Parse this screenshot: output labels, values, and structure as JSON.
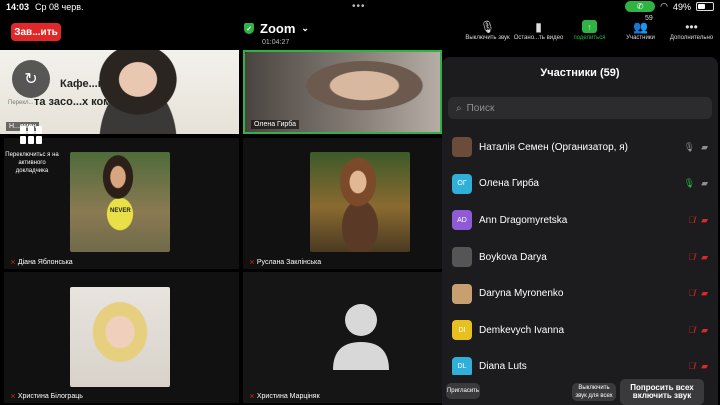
{
  "status_bar": {
    "time": "14:03",
    "date": "Ср 08 черв.",
    "battery": "49%"
  },
  "top_bar": {
    "leave_label": "Зав...ить",
    "app_title": "Zoom",
    "elapsed": "01:04:27"
  },
  "toolbar": [
    {
      "label": "Выключить звук",
      "icon": "mic-icon",
      "glyph": "🎙"
    },
    {
      "label": "Остано...ть видео",
      "icon": "camera-icon",
      "glyph": "▮"
    },
    {
      "label": "поделиться",
      "icon": "share-icon",
      "glyph": "↑"
    },
    {
      "label": "Участники",
      "icon": "participants-icon",
      "glyph": "👥",
      "count": "59"
    },
    {
      "label": "Дополнительно",
      "icon": "more-icon",
      "glyph": "•••"
    }
  ],
  "tiles": [
    {
      "name": "Н...емен",
      "slide_line1": "Кафе...налістики",
      "slide_line2": "та засо...х комунікації",
      "slide_small": "Перекл..."
    },
    {
      "name": "Олена Гирба"
    },
    {
      "name": "Діана Яблонська",
      "shirt_text": "NEVER"
    },
    {
      "name": "Руслана Заклінська"
    },
    {
      "name": "Христина Білограць"
    },
    {
      "name": "Христина Марціняк"
    }
  ],
  "speaker_switch_label": "Переключитьс я на активного докладчика",
  "panel": {
    "title": "Участники (59)",
    "search_placeholder": "Поиск",
    "participants": [
      {
        "name": "Наталія Семен (Организатор, я)",
        "initials": "",
        "avatar_color": "#6b4c3b",
        "mic": "on",
        "video": "on"
      },
      {
        "name": "Олена Гирба",
        "initials": "ОГ",
        "avatar_color": "#30b0d8",
        "mic": "speaking",
        "video": "on"
      },
      {
        "name": "Ann Dragomyretska",
        "initials": "AD",
        "avatar_color": "#8e5ad6",
        "mic": "off",
        "video": "off"
      },
      {
        "name": "Boykova Darya",
        "initials": "",
        "avatar_color": "#555555",
        "mic": "off",
        "video": "off"
      },
      {
        "name": "Daryna Myronenko",
        "initials": "",
        "avatar_color": "#c8a070",
        "mic": "off",
        "video": "off"
      },
      {
        "name": "Demkevych Ivanna",
        "initials": "DI",
        "avatar_color": "#e8c020",
        "mic": "off",
        "video": "off"
      },
      {
        "name": "Diana Luts",
        "initials": "DL",
        "avatar_color": "#30b0d8",
        "mic": "off",
        "video": "off"
      }
    ],
    "invite_label": "Пригласить",
    "mute_all_label": "Выключить звук для всех",
    "ask_unmute_label": "Попросить всех включить звук"
  }
}
